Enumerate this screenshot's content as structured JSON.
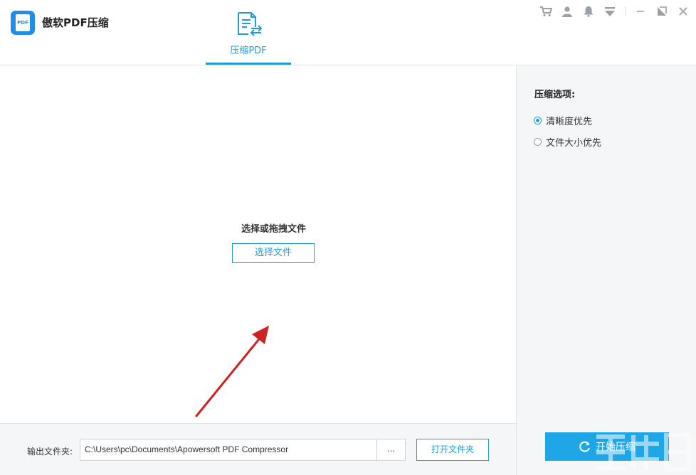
{
  "app": {
    "title": "傲软PDF压缩",
    "logo_text": "PDF"
  },
  "tabs": [
    {
      "label": "压缩PDF",
      "active": true
    }
  ],
  "window_controls": [
    "cart-icon",
    "user-icon",
    "bell-icon",
    "menu-dropdown-icon",
    "minimize-icon",
    "restore-icon",
    "close-icon"
  ],
  "workspace": {
    "drop_title": "选择或拖拽文件",
    "select_button": "选择文件"
  },
  "sidebar": {
    "title": "压缩选项:",
    "options": [
      {
        "label": "清晰度优先",
        "selected": true
      },
      {
        "label": "文件大小优先",
        "selected": false
      }
    ],
    "start_button": "开始压缩"
  },
  "output": {
    "label": "输出文件夹:",
    "path": "C:\\Users\\pc\\Documents\\Apowersoft PDF Compressor",
    "browse_label": "...",
    "open_button": "打开文件夹"
  },
  "colors": {
    "accent": "#1f9bd8",
    "start_button": "#1fa6e6",
    "logo": "#1f8ee8",
    "annotation_arrow": "#cc2222"
  }
}
